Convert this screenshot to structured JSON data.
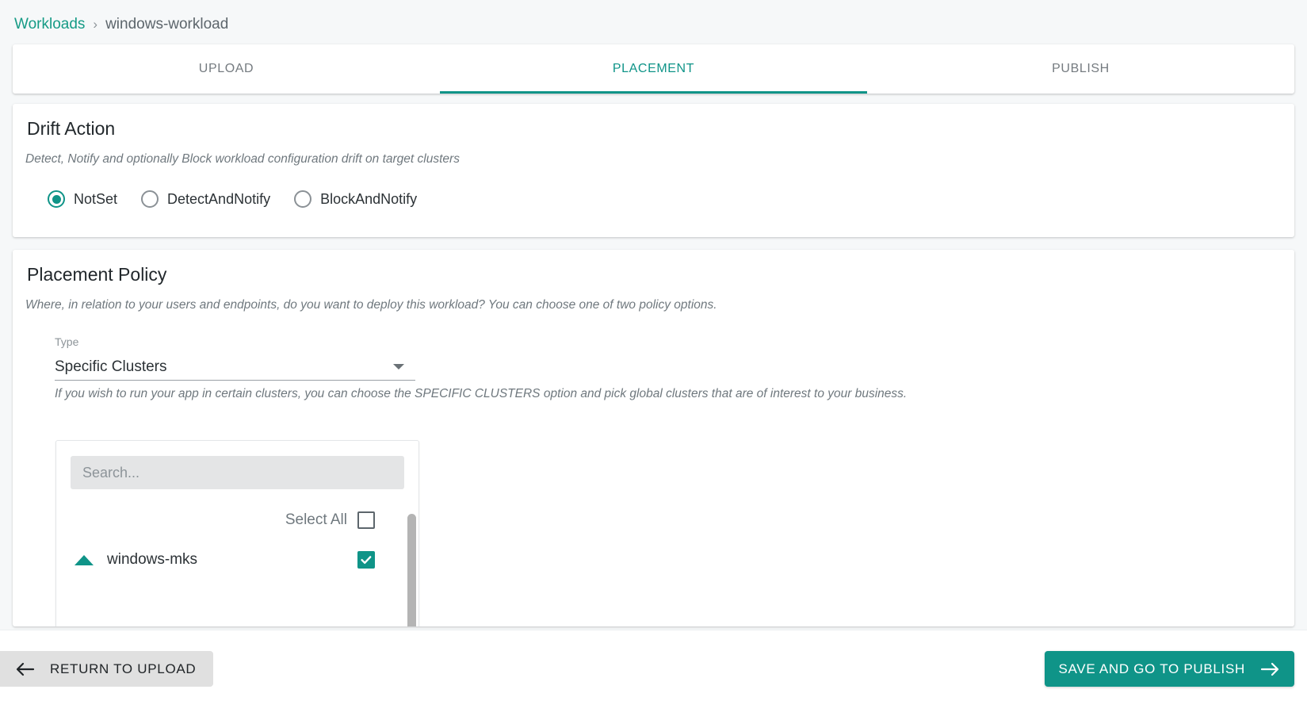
{
  "breadcrumb": {
    "root_label": "Workloads",
    "separator": "›",
    "current_label": "windows-workload"
  },
  "tabs": [
    {
      "label": "UPLOAD",
      "active": false
    },
    {
      "label": "PLACEMENT",
      "active": true
    },
    {
      "label": "PUBLISH",
      "active": false
    }
  ],
  "drift_action": {
    "title": "Drift Action",
    "subtitle": "Detect, Notify and optionally Block workload configuration drift on target clusters",
    "options": [
      {
        "label": "NotSet",
        "selected": true
      },
      {
        "label": "DetectAndNotify",
        "selected": false
      },
      {
        "label": "BlockAndNotify",
        "selected": false
      }
    ]
  },
  "placement_policy": {
    "title": "Placement Policy",
    "subtitle": "Where, in relation to your users and endpoints, do you want to deploy this workload? You can choose one of two policy options.",
    "type_field": {
      "label": "Type",
      "value": "Specific Clusters"
    },
    "hint": "If you wish to run your app in certain clusters, you can choose the SPECIFIC CLUSTERS option and pick global clusters that are of interest to your business.",
    "cluster_picker": {
      "search_placeholder": "Search...",
      "search_value": "",
      "select_all_label": "Select All",
      "select_all_checked": false,
      "clusters": [
        {
          "name": "windows-mks",
          "checked": true,
          "expanded": true
        }
      ]
    }
  },
  "footer": {
    "return_label": "RETURN TO UPLOAD",
    "save_label": "SAVE AND GO TO PUBLISH"
  },
  "colors": {
    "accent": "#0f9488",
    "link": "#169b86",
    "page_background": "#f6f8f9",
    "card_background": "#ffffff",
    "muted_text": "#6f787e"
  }
}
